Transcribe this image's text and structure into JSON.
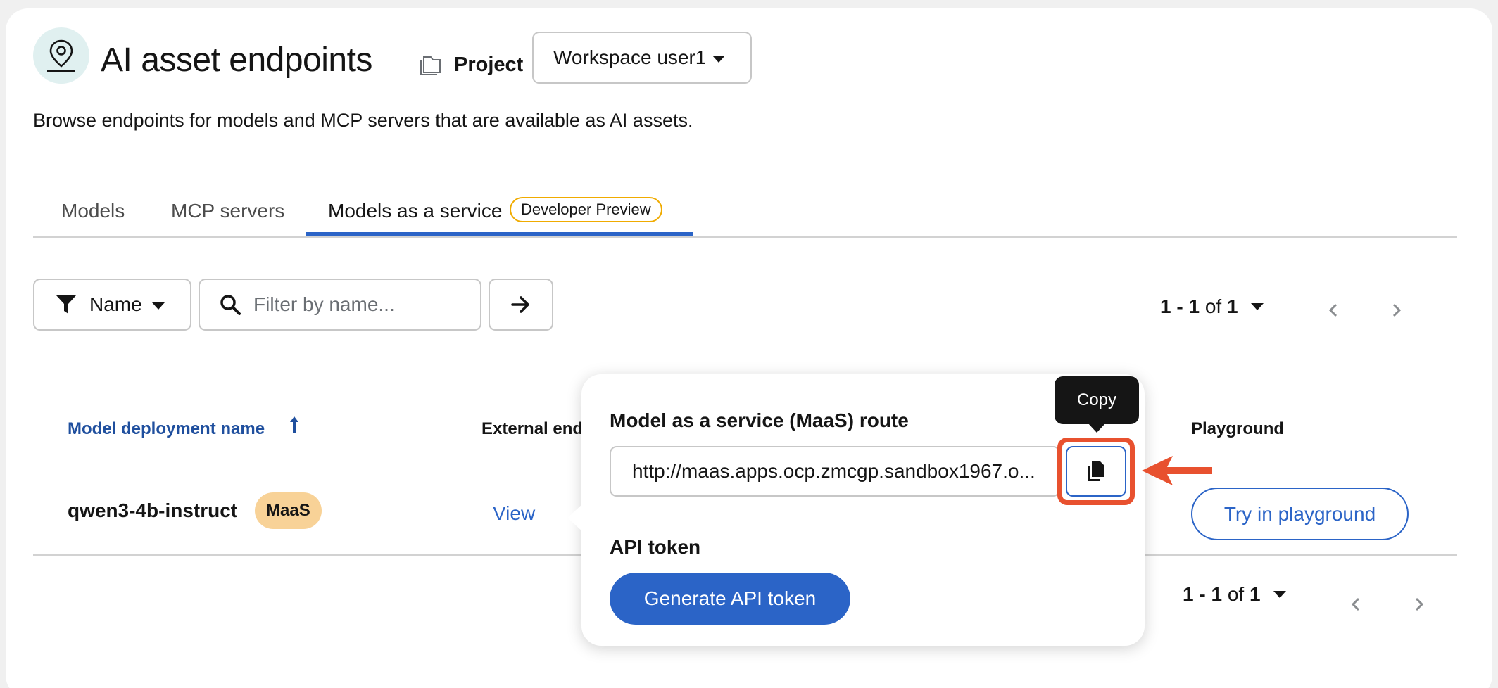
{
  "header": {
    "title": "AI asset endpoints",
    "project_label": "Project",
    "project_value": "Workspace user1",
    "description": "Browse endpoints for models and MCP servers that are available as AI assets."
  },
  "tabs": [
    {
      "label": "Models",
      "active": false
    },
    {
      "label": "MCP servers",
      "active": false
    },
    {
      "label": "Models as a service",
      "active": true,
      "badge": "Developer Preview"
    }
  ],
  "toolbar": {
    "filter_attribute": "Name",
    "search_placeholder": "Filter by name...",
    "pagination": {
      "range": "1 - 1",
      "of_label": "of",
      "total": "1"
    }
  },
  "table": {
    "columns": {
      "name": "Model deployment name",
      "external_endpoint": "External end",
      "playground": "Playground"
    },
    "rows": [
      {
        "name": "qwen3-4b-instruct",
        "badge": "MaaS",
        "endpoint_link": "View",
        "playground_button": "Try in playground"
      }
    ]
  },
  "popover": {
    "route_title": "Model as a service (MaaS) route",
    "route_value": "http://maas.apps.ocp.zmcgp.sandbox1967.o...",
    "copy_tooltip": "Copy",
    "token_title": "API token",
    "generate_button": "Generate API token"
  },
  "colors": {
    "accent": "#2b64c7",
    "highlight": "#e8512f",
    "badge_maas": "#f8d297",
    "badge_preview_border": "#f0ab00"
  },
  "icons": {
    "page": "map-pin-icon",
    "project": "folder-icon",
    "filter": "filter-icon",
    "search": "search-icon",
    "go": "arrow-right-icon",
    "sort": "sort-asc-icon",
    "copy": "copy-icon"
  }
}
